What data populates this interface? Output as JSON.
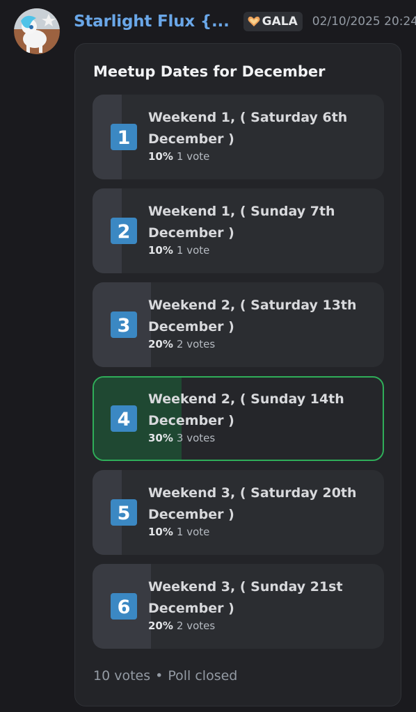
{
  "message": {
    "author": "Starlight Flux {...",
    "guild_tag": "GALA",
    "timestamp": "02/10/2025 20:24"
  },
  "poll": {
    "question": "Meetup Dates for December",
    "answers": [
      {
        "emoji": "1",
        "label": "Weekend 1, ( Saturday 6th December )",
        "percent": "10%",
        "votes": "1 vote",
        "fraction": 0.1,
        "selected": false
      },
      {
        "emoji": "2",
        "label": "Weekend 1, ( Sunday 7th December )",
        "percent": "10%",
        "votes": "1 vote",
        "fraction": 0.1,
        "selected": false
      },
      {
        "emoji": "3",
        "label": "Weekend 2, ( Saturday 13th December )",
        "percent": "20%",
        "votes": "2 votes",
        "fraction": 0.2,
        "selected": false
      },
      {
        "emoji": "4",
        "label": "Weekend 2, ( Sunday 14th December )",
        "percent": "30%",
        "votes": "3 votes",
        "fraction": 0.3,
        "selected": true
      },
      {
        "emoji": "5",
        "label": "Weekend 3, ( Saturday 20th December )",
        "percent": "10%",
        "votes": "1 vote",
        "fraction": 0.1,
        "selected": false
      },
      {
        "emoji": "6",
        "label": "Weekend 3, ( Sunday 21st December )",
        "percent": "20%",
        "votes": "2 votes",
        "fraction": 0.2,
        "selected": false
      }
    ],
    "total_votes": "10 votes",
    "separator": "•",
    "status": "Poll closed"
  },
  "colors": {
    "username": "#6aa7e8",
    "winner_border": "#2fae59",
    "keycap": "#3b88c3"
  }
}
